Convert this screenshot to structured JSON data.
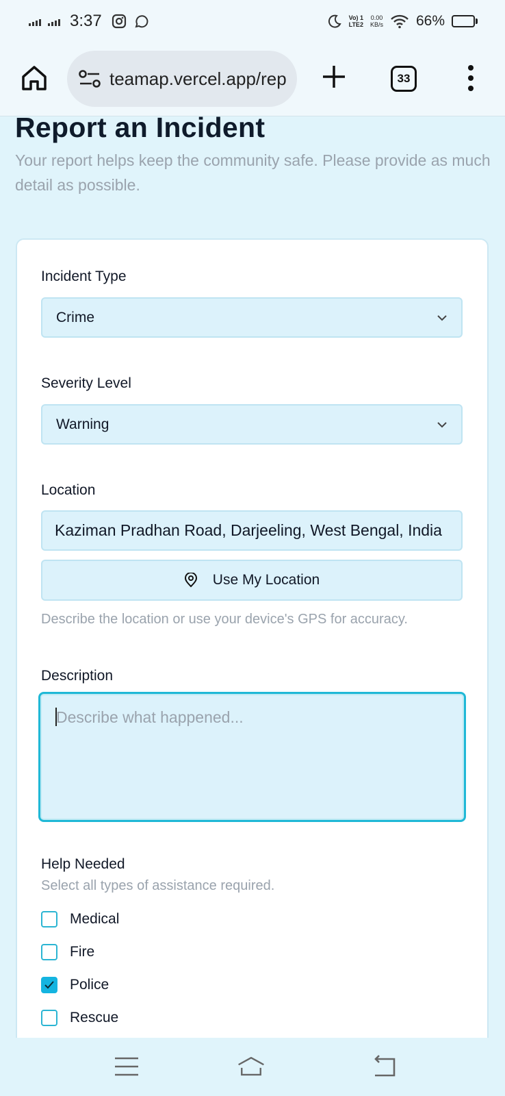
{
  "status_bar": {
    "time": "3:37",
    "network_label_top": "Vo) 1",
    "network_label_bottom": "LTE2",
    "data_rate_top": "0.00",
    "data_rate_bottom": "KB/s",
    "battery": "66%",
    "battery_level": 0.66
  },
  "browser": {
    "url": "teamap.vercel.app/rep",
    "tab_count": "33"
  },
  "page": {
    "title": "Report an Incident",
    "subtitle": "Your report helps keep the community safe. Please provide as much detail as possible."
  },
  "form": {
    "incident_type": {
      "label": "Incident Type",
      "value": "Crime"
    },
    "severity": {
      "label": "Severity Level",
      "value": "Warning"
    },
    "location": {
      "label": "Location",
      "value": "Kaziman Pradhan Road, Darjeeling, West Bengal, India",
      "button_label": "Use My Location",
      "hint": "Describe the location or use your device's GPS for accuracy."
    },
    "description": {
      "label": "Description",
      "placeholder": "Describe what happened..."
    },
    "help_needed": {
      "label": "Help Needed",
      "hint": "Select all types of assistance required.",
      "options": [
        {
          "label": "Medical",
          "checked": false
        },
        {
          "label": "Fire",
          "checked": false
        },
        {
          "label": "Police",
          "checked": true
        },
        {
          "label": "Rescue",
          "checked": false
        }
      ]
    }
  },
  "colors": {
    "page_background": "#e0f4fb",
    "field_background": "#dcf2fb",
    "accent": "#14b4e0"
  }
}
